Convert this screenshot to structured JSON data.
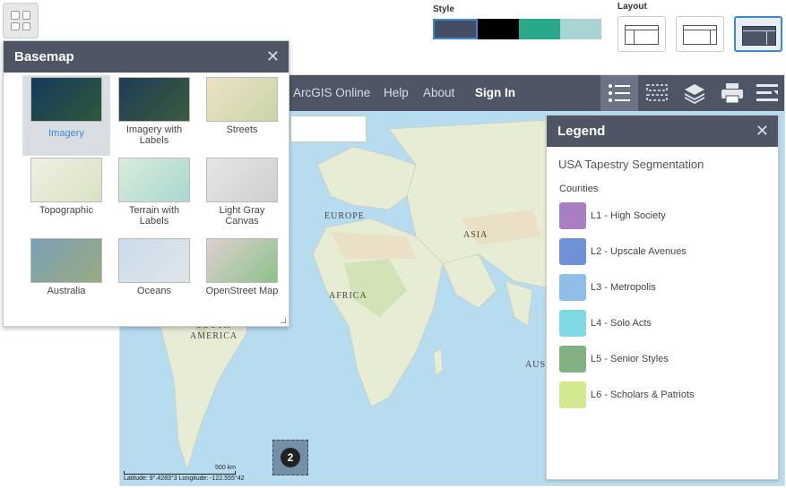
{
  "style": {
    "caption": "Style",
    "swatches": [
      "#444e62",
      "#000000",
      "#27a98a",
      "#a8d4d4"
    ],
    "selected_index": 0
  },
  "layout": {
    "caption": "Layout",
    "selected_index": 2
  },
  "topbar": {
    "nav": [
      "ArcGIS Online",
      "Help",
      "About"
    ],
    "sign_in": "Sign In",
    "tools": [
      "legend-icon",
      "layer-list-icon",
      "layers-icon",
      "print-icon",
      "menu-icon"
    ],
    "active_tool_index": 0
  },
  "map": {
    "labels": {
      "europe": "EUROPE",
      "asia": "ASIA",
      "africa": "AFRICA",
      "south_america": "SOUTH\nAMERICA",
      "australia": "AUS"
    },
    "cluster_count": "2",
    "scale": "500 km",
    "coords": "Latitude: 9°.4283°3  Longitude: -122.555°42",
    "colors": {
      "water": "#b8dcef",
      "land": "#e7ecd5",
      "forest": "#cfe3b4"
    }
  },
  "legend": {
    "title": "Legend",
    "layer_title": "USA Tapestry Segmentation",
    "subtitle": "Counties",
    "items": [
      {
        "label": "L1 - High Society",
        "color": "#a97fc4"
      },
      {
        "label": "L2 - Upscale Avenues",
        "color": "#6f92d6"
      },
      {
        "label": "L3 - Metropolis",
        "color": "#8fbfe8"
      },
      {
        "label": "L4 - Solo Acts",
        "color": "#7fdae6"
      },
      {
        "label": "L5 - Senior Styles",
        "color": "#83b183"
      },
      {
        "label": "L6 - Scholars & Patriots",
        "color": "#d3e98e"
      }
    ]
  },
  "basemap": {
    "title": "Basemap",
    "selected_index": 0,
    "items": [
      {
        "label": "Imagery",
        "colors": [
          "#163a5c",
          "#2d5a3a"
        ]
      },
      {
        "label": "Imagery with Labels",
        "colors": [
          "#1e3c56",
          "#3c5c3e"
        ]
      },
      {
        "label": "Streets",
        "colors": [
          "#ede2c6",
          "#c9d5a8"
        ]
      },
      {
        "label": "Topographic",
        "colors": [
          "#f2efe6",
          "#d8e3c1"
        ]
      },
      {
        "label": "Terrain with Labels",
        "colors": [
          "#d9ecd9",
          "#a9d8d2"
        ]
      },
      {
        "label": "Light Gray Canvas",
        "colors": [
          "#e6e6e6",
          "#cfcfcf"
        ]
      },
      {
        "label": "Australia",
        "colors": [
          "#7aa0b8",
          "#9aab80"
        ]
      },
      {
        "label": "Oceans",
        "colors": [
          "#c9dcea",
          "#dfe6ea"
        ]
      },
      {
        "label": "OpenStreet Map",
        "colors": [
          "#e0cfcf",
          "#8bc38b"
        ]
      }
    ]
  }
}
